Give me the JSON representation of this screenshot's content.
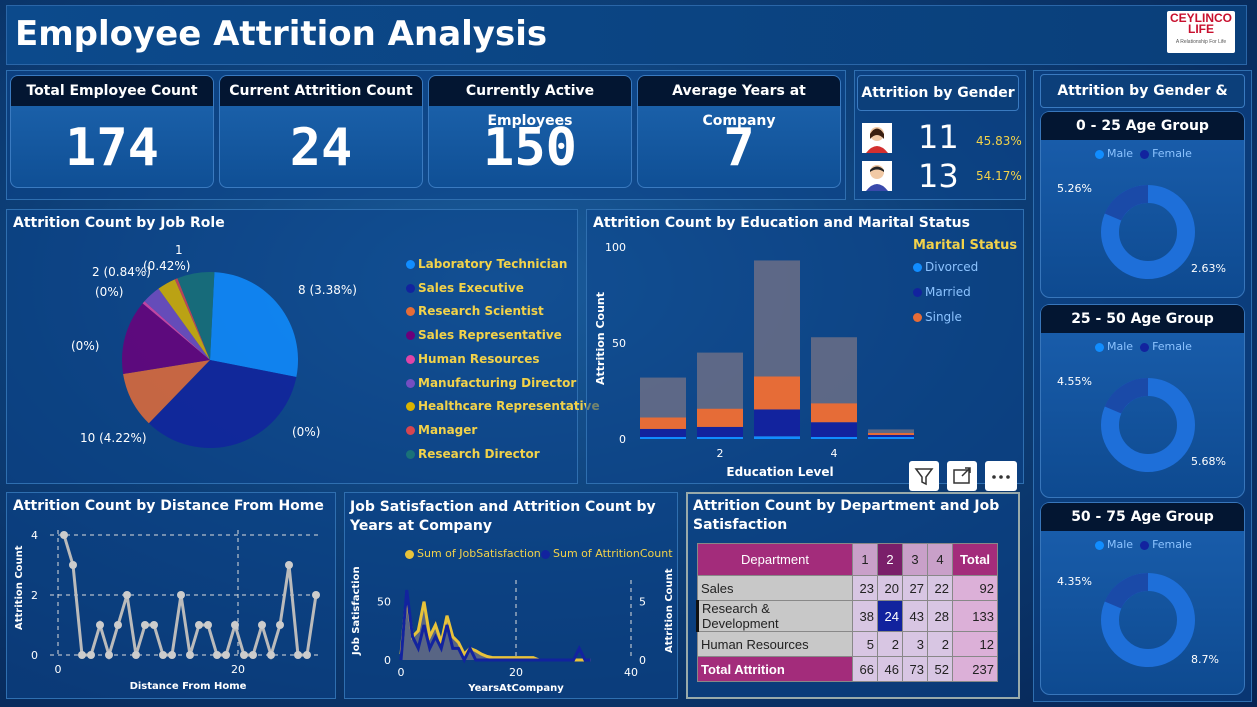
{
  "app": {
    "title": "Employee Attrition Analysis",
    "logo_text": "CEYLINCO LIFE",
    "logo_sub": "A Relationship For Life"
  },
  "kpis": [
    {
      "label": "Total Employee Count",
      "value": "174"
    },
    {
      "label": "Current Attrition Count",
      "value": "24"
    },
    {
      "label": "Currently Active Employees",
      "value": "150"
    },
    {
      "label": "Average Years at Company",
      "value": "7"
    }
  ],
  "gender": {
    "title": "Attrition by Gender",
    "female_count": "11",
    "female_pct": "45.83%",
    "male_count": "13",
    "male_pct": "54.17%"
  },
  "job_role": {
    "title": "Attrition Count by Job Role",
    "legend": [
      "Laboratory Technician",
      "Sales Executive",
      "Research Scientist",
      "Sales Representative",
      "Human Resources",
      "Manufacturing Director",
      "Healthcare Representative",
      "Manager",
      "Research Director"
    ],
    "labels": {
      "l1": "8 (3.38%)",
      "l2": "(0%)",
      "l3": "10 (4.22%)",
      "l4": "(0%)",
      "l5": "(0%)",
      "l6": "2 (0.84%)",
      "l7": "(0.42%)",
      "l8": "1"
    },
    "colors": [
      "#118dff",
      "#12239e",
      "#e66c37",
      "#6b007b",
      "#e044a7",
      "#744ec2",
      "#d9b300",
      "#d64550",
      "#197278"
    ]
  },
  "edu": {
    "title": "Attrition Count by Education and Marital Status",
    "legend_title": "Marital Status",
    "legend": [
      "Divorced",
      "Married",
      "Single"
    ],
    "ylabel": "Attrition Count",
    "xlabel": "Education Level",
    "yticks": [
      "100",
      "50",
      "0"
    ],
    "xticks": [
      "2",
      "4"
    ]
  },
  "distance": {
    "title": "Attrition Count by Distance From Home",
    "ylabel": "Attrition Count",
    "xlabel": "Distance From Home",
    "yticks": [
      "4",
      "2",
      "0"
    ],
    "xticks": [
      "0",
      "20"
    ]
  },
  "years": {
    "title": "Job Satisfaction and Attrition Count by Years at Company",
    "legend": [
      "Sum of JobSatisfaction",
      "Sum of AttritionCount"
    ],
    "ylabel": "Job Satisfaction",
    "y2label": "Attrition Count",
    "xlabel": "YearsAtCompany",
    "yticks": [
      "50",
      "0"
    ],
    "y2ticks": [
      "5",
      "0"
    ],
    "xticks": [
      "0",
      "20",
      "40"
    ]
  },
  "dept": {
    "title": "Attrition Count by Department and Job Satisfaction",
    "header": [
      "Department",
      "1",
      "2",
      "3",
      "4",
      "Total"
    ],
    "rows": [
      [
        "Sales",
        "23",
        "20",
        "27",
        "22",
        "92"
      ],
      [
        "Research & Development",
        "38",
        "24",
        "43",
        "28",
        "133"
      ],
      [
        "Human Resources",
        "5",
        "2",
        "3",
        "2",
        "12"
      ],
      [
        "Total Attrition",
        "66",
        "46",
        "73",
        "52",
        "237"
      ]
    ]
  },
  "age": {
    "title": "Attrition by Gender & Age",
    "legend": [
      "Male",
      "Female"
    ],
    "groups": [
      {
        "name": "0 - 25 Age Group",
        "left_pct": "5.26%",
        "right_pct": "2.63%"
      },
      {
        "name": "25 - 50 Age Group",
        "left_pct": "4.55%",
        "right_pct": "5.68%"
      },
      {
        "name": "50 - 75 Age Group",
        "left_pct": "4.35%",
        "right_pct": "8.7%"
      }
    ]
  },
  "chart_data": [
    {
      "type": "pie",
      "title": "Attrition Count by Job Role",
      "categories": [
        "Laboratory Technician",
        "Sales Executive",
        "Research Scientist",
        "Sales Representative",
        "Human Resources",
        "Manufacturing Director",
        "Healthcare Representative",
        "Manager",
        "Research Director"
      ],
      "values": [
        8,
        10,
        3,
        4,
        0,
        1,
        1,
        0,
        2
      ]
    },
    {
      "type": "bar",
      "title": "Attrition Count by Education and Marital Status",
      "categories": [
        "1",
        "2",
        "3",
        "4",
        "5"
      ],
      "series": [
        {
          "name": "Divorced",
          "values": [
            3,
            3,
            4,
            3,
            1
          ]
        },
        {
          "name": "Married",
          "values": [
            12,
            15,
            40,
            22,
            1
          ]
        },
        {
          "name": "Single",
          "values": [
            17,
            27,
            49,
            28,
            3
          ]
        }
      ],
      "ylim": [
        0,
        100
      ]
    },
    {
      "type": "line",
      "title": "Attrition Count by Distance From Home",
      "x": [
        1,
        2,
        3,
        4,
        5,
        6,
        7,
        8,
        9,
        10,
        11,
        12,
        13,
        14,
        15,
        16,
        17,
        18,
        19,
        20,
        21,
        22,
        23,
        24,
        25,
        26,
        27,
        28,
        29
      ],
      "values": [
        4,
        3,
        0,
        0,
        1,
        0,
        1,
        2,
        0,
        1,
        1,
        0,
        0,
        2,
        0,
        1,
        1,
        0,
        0,
        1,
        0,
        0,
        1,
        0,
        1,
        3,
        0,
        0,
        2
      ],
      "ylim": [
        0,
        4
      ]
    },
    {
      "type": "area",
      "title": "Job Satisfaction and Attrition Count by Years at Company",
      "x": [
        0,
        1,
        2,
        3,
        4,
        5,
        6,
        7,
        8,
        9,
        10,
        11,
        12,
        13,
        14,
        15,
        16,
        17,
        18,
        19,
        20,
        21,
        22,
        23,
        24,
        25,
        26,
        27,
        28,
        29,
        30,
        31,
        32,
        33
      ],
      "series": [
        {
          "name": "Sum of JobSatisfaction",
          "values": [
            5,
            55,
            20,
            25,
            50,
            20,
            30,
            15,
            38,
            20,
            15,
            5,
            10,
            8,
            5,
            3,
            2,
            2,
            2,
            2,
            2,
            2,
            2,
            2,
            0,
            0,
            0,
            0,
            0,
            0,
            0,
            0,
            0,
            0
          ]
        },
        {
          "name": "Sum of AttritionCount",
          "values": [
            0,
            6,
            2,
            1,
            3,
            1,
            2,
            1,
            3,
            1,
            1,
            0,
            1,
            0,
            0,
            0,
            0,
            0,
            0,
            0,
            0,
            0,
            0,
            0,
            0,
            0,
            0,
            0,
            0,
            0,
            0,
            1,
            0,
            0
          ]
        }
      ]
    },
    {
      "type": "table",
      "title": "Attrition Count by Department and Job Satisfaction"
    }
  ]
}
